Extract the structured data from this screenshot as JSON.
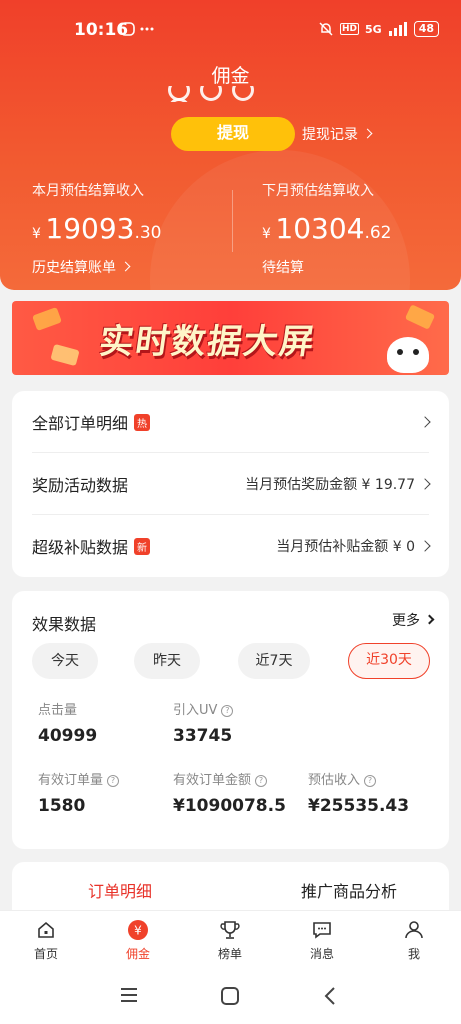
{
  "status_bar": {
    "time": "10:16",
    "network": "5G",
    "battery": "48"
  },
  "header": {
    "title": "佣金",
    "withdraw_label": "提现",
    "withdraw_record_label": "提现记录",
    "this_month": {
      "label": "本月预估结算收入",
      "currency": "¥",
      "int": "19093",
      "dec": ".30",
      "sub_label": "历史结算账单"
    },
    "next_month": {
      "label": "下月预估结算收入",
      "currency": "¥",
      "int": "10304",
      "dec": ".62",
      "sub_label": "待结算"
    }
  },
  "banner": {
    "text": "实时数据大屏"
  },
  "menu": {
    "rows": [
      {
        "label": "全部订单明细",
        "tag": "热",
        "right": ""
      },
      {
        "label": "奖励活动数据",
        "tag": "",
        "right": "当月预估奖励金额 ¥ 19.77"
      },
      {
        "label": "超级补贴数据",
        "tag": "新",
        "right": "当月预估补贴金额 ¥ 0"
      }
    ]
  },
  "effect": {
    "title": "效果数据",
    "more": "更多",
    "ranges": [
      "今天",
      "昨天",
      "近7天",
      "近30天"
    ],
    "selected_range": "近30天",
    "metrics": [
      {
        "label": "点击量",
        "value": "40999"
      },
      {
        "label": "引入UV",
        "value": "33745"
      },
      {
        "label": "有效订单量",
        "value": "1580"
      },
      {
        "label": "有效订单金额",
        "value": "¥1090078.5"
      },
      {
        "label": "预估收入",
        "value": "¥25535.43"
      }
    ]
  },
  "sub_tabs": {
    "tab1": "订单明细",
    "tab2": "推广商品分析"
  },
  "bottom_nav": {
    "items": [
      {
        "label": "首页",
        "icon": "home-icon"
      },
      {
        "label": "佣金",
        "icon": "yen-icon"
      },
      {
        "label": "榜单",
        "icon": "trophy-icon"
      },
      {
        "label": "消息",
        "icon": "message-icon"
      },
      {
        "label": "我",
        "icon": "person-icon"
      }
    ],
    "active": "佣金"
  },
  "colors": {
    "accent": "#f0412a",
    "withdraw": "#ffc10a"
  }
}
